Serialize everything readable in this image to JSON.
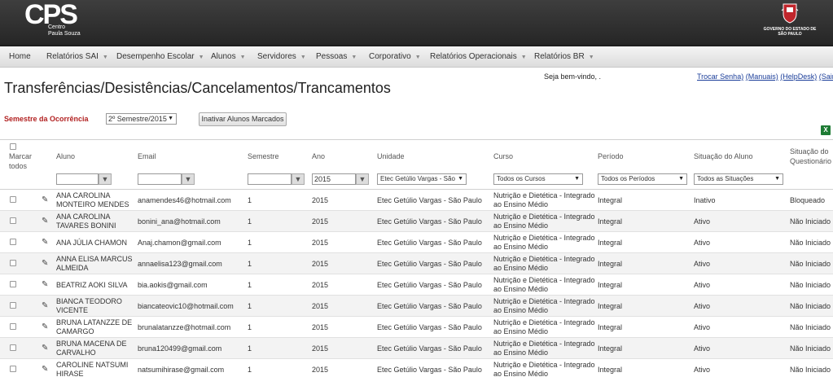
{
  "header": {
    "logo_text": "CPS",
    "logo_subtitle": "Centro Paula Souza",
    "gov_text": "GOVERNO DO ESTADO DE SÃO PAULO"
  },
  "menu": [
    {
      "label": "Home",
      "has_caret": false
    },
    {
      "label": "Relatórios SAI",
      "has_caret": true
    },
    {
      "label": "Desempenho Escolar",
      "has_caret": true
    },
    {
      "label": "Alunos",
      "has_caret": true
    },
    {
      "label": "Servidores",
      "has_caret": true
    },
    {
      "label": "Pessoas",
      "has_caret": true
    },
    {
      "label": "Corporativo",
      "has_caret": true
    },
    {
      "label": "Relatórios Operacionais",
      "has_caret": true
    },
    {
      "label": "Relatórios BR",
      "has_caret": true
    }
  ],
  "page": {
    "title": "Transferências/Desistências/Cancelamentos/Trancamentos",
    "welcome": "Seja bem-vindo, .",
    "links": [
      "Trocar Senha)",
      "(Manuais)",
      "(HelpDesk)",
      "(Sair)"
    ]
  },
  "controls": {
    "semester_label": "Semestre da Ocorrência",
    "semester_value": "2º Semestre/2015",
    "inactivate_button": "Inativar Alunos Marcados",
    "excel_icon_glyph": "X"
  },
  "table": {
    "headers": {
      "select_all": "Marcar todos",
      "aluno": "Aluno",
      "email": "Email",
      "semestre": "Semestre",
      "ano": "Ano",
      "unidade": "Unidade",
      "curso": "Curso",
      "periodo": "Período",
      "situacao_aluno": "Situação do Aluno",
      "situacao_questionario": "Situação do Questionário"
    },
    "filters": {
      "aluno": "",
      "email": "",
      "semestre": "",
      "ano": "2015",
      "unidade": "Etec Getúlio Vargas - São",
      "curso": "Todos os Cursos",
      "periodo": "Todos os Períodos",
      "situacao": "Todos as Situações"
    },
    "rows": [
      {
        "aluno": [
          "ANA CAROLINA",
          "MONTEIRO MENDES"
        ],
        "email": "anamendes46@hotmail.com",
        "semestre": "1",
        "ano": "2015",
        "unidade": "Etec Getúlio Vargas - São Paulo",
        "curso": [
          "Nutrição e Dietética - Integrado",
          "ao Ensino Médio"
        ],
        "periodo": "Integral",
        "situacao": "Inativo",
        "questionario": "Bloqueado"
      },
      {
        "aluno": [
          "ANA CAROLINA",
          "TAVARES BONINI"
        ],
        "email": "bonini_ana@hotmail.com",
        "semestre": "1",
        "ano": "2015",
        "unidade": "Etec Getúlio Vargas - São Paulo",
        "curso": [
          "Nutrição e Dietética - Integrado",
          "ao Ensino Médio"
        ],
        "periodo": "Integral",
        "situacao": "Ativo",
        "questionario": "Não Iniciado"
      },
      {
        "aluno": [
          "ANA JÚLIA CHAMON"
        ],
        "email": "Anaj.chamon@gmail.com",
        "semestre": "1",
        "ano": "2015",
        "unidade": "Etec Getúlio Vargas - São Paulo",
        "curso": [
          "Nutrição e Dietética - Integrado",
          "ao Ensino Médio"
        ],
        "periodo": "Integral",
        "situacao": "Ativo",
        "questionario": "Não Iniciado"
      },
      {
        "aluno": [
          "ANNA ELISA MARCUS",
          "ALMEIDA"
        ],
        "email": "annaelisa123@gmail.com",
        "semestre": "1",
        "ano": "2015",
        "unidade": "Etec Getúlio Vargas - São Paulo",
        "curso": [
          "Nutrição e Dietética - Integrado",
          "ao Ensino Médio"
        ],
        "periodo": "Integral",
        "situacao": "Ativo",
        "questionario": "Não Iniciado"
      },
      {
        "aluno": [
          "BEATRIZ AOKI SILVA"
        ],
        "email": "bia.aokis@gmail.com",
        "semestre": "1",
        "ano": "2015",
        "unidade": "Etec Getúlio Vargas - São Paulo",
        "curso": [
          "Nutrição e Dietética - Integrado",
          "ao Ensino Médio"
        ],
        "periodo": "Integral",
        "situacao": "Ativo",
        "questionario": "Não Iniciado"
      },
      {
        "aluno": [
          "BIANCA TEODORO",
          "VICENTE"
        ],
        "email": "biancateovic10@hotmail.com",
        "semestre": "1",
        "ano": "2015",
        "unidade": "Etec Getúlio Vargas - São Paulo",
        "curso": [
          "Nutrição e Dietética - Integrado",
          "ao Ensino Médio"
        ],
        "periodo": "Integral",
        "situacao": "Ativo",
        "questionario": "Não Iniciado"
      },
      {
        "aluno": [
          "BRUNA LATANZZE DE",
          "CAMARGO"
        ],
        "email": "brunalatanzze@hotmail.com",
        "semestre": "1",
        "ano": "2015",
        "unidade": "Etec Getúlio Vargas - São Paulo",
        "curso": [
          "Nutrição e Dietética - Integrado",
          "ao Ensino Médio"
        ],
        "periodo": "Integral",
        "situacao": "Ativo",
        "questionario": "Não Iniciado"
      },
      {
        "aluno": [
          "BRUNA MACENA DE",
          "CARVALHO"
        ],
        "email": "bruna120499@gmail.com",
        "semestre": "1",
        "ano": "2015",
        "unidade": "Etec Getúlio Vargas - São Paulo",
        "curso": [
          "Nutrição e Dietética - Integrado",
          "ao Ensino Médio"
        ],
        "periodo": "Integral",
        "situacao": "Ativo",
        "questionario": "Não Iniciado"
      },
      {
        "aluno": [
          "CAROLINE NATSUMI",
          "HIRASE"
        ],
        "email": "natsumihirase@gmail.com",
        "semestre": "1",
        "ano": "2015",
        "unidade": "Etec Getúlio Vargas - São Paulo",
        "curso": [
          "Nutrição e Dietética - Integrado",
          "ao Ensino Médio"
        ],
        "periodo": "Integral",
        "situacao": "Ativo",
        "questionario": "Não Iniciado"
      }
    ]
  }
}
